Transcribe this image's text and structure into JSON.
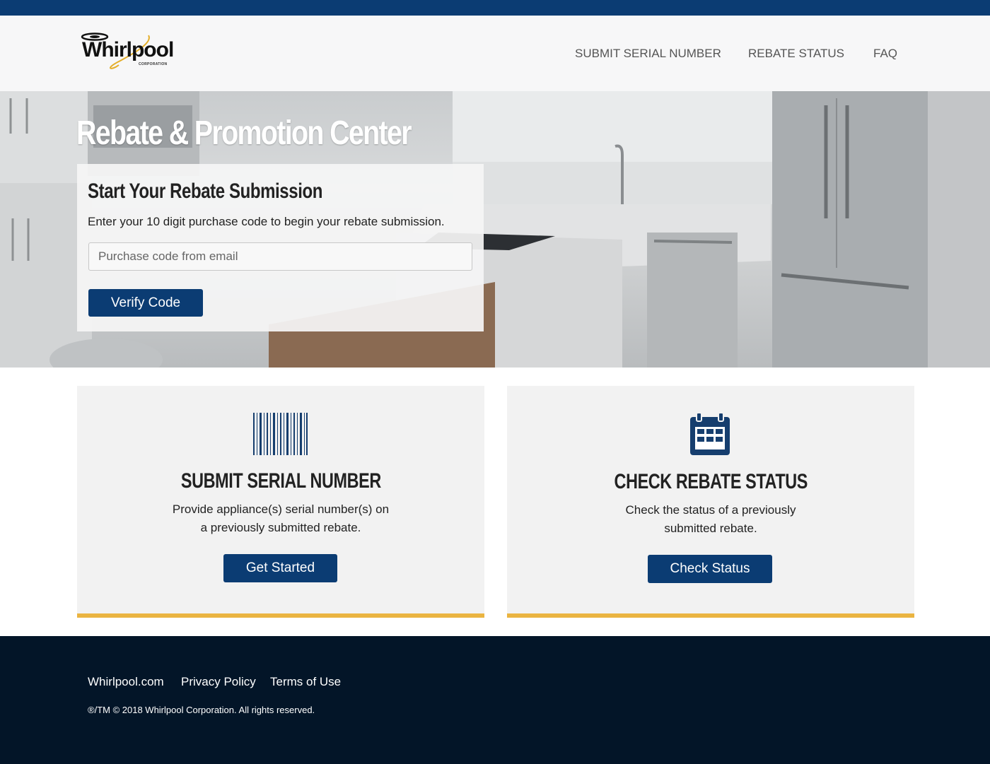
{
  "brand": {
    "logo_text": "Whirlpool",
    "logo_subtext": "CORPORATION"
  },
  "nav": {
    "items": [
      {
        "label": "SUBMIT SERIAL NUMBER"
      },
      {
        "label": "REBATE STATUS"
      },
      {
        "label": "FAQ"
      }
    ]
  },
  "hero": {
    "title": "Rebate & Promotion Center",
    "card": {
      "title": "Start Your Rebate Submission",
      "description": "Enter your 10 digit purchase code to begin your rebate submission.",
      "input_placeholder": "Purchase code from email",
      "input_value": "",
      "button_label": "Verify Code"
    }
  },
  "features": [
    {
      "icon": "barcode-icon",
      "title": "SUBMIT SERIAL NUMBER",
      "description_line1": "Provide appliance(s) serial number(s) on",
      "description_line2": "a previously submitted rebate.",
      "button_label": "Get Started"
    },
    {
      "icon": "calendar-icon",
      "title": "CHECK REBATE STATUS",
      "description_line1": "Check the status of a previously",
      "description_line2": "submitted rebate.",
      "button_label": "Check Status"
    }
  ],
  "footer": {
    "links": [
      {
        "label": "Whirlpool.com"
      },
      {
        "label": "Privacy Policy"
      },
      {
        "label": "Terms of Use"
      }
    ],
    "copyright": "®/TM © 2018 Whirlpool Corporation. All rights reserved."
  },
  "colors": {
    "brand_navy": "#0b3c73",
    "accent_gold": "#eab441",
    "footer_bg": "#031528"
  }
}
